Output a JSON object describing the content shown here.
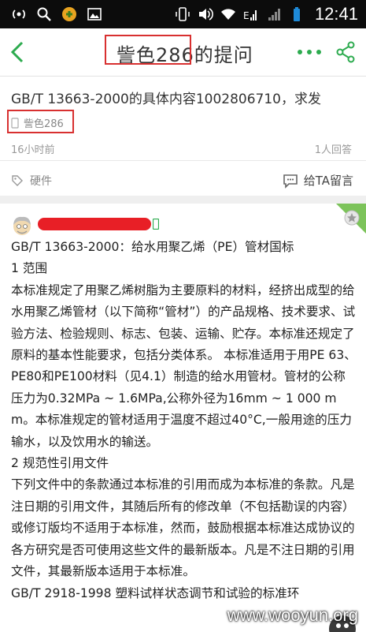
{
  "status_bar": {
    "time": "12:41"
  },
  "nav": {
    "title": "訾色286的提问"
  },
  "question": {
    "title": "GB/T 13663-2000的具体内容1002806710，求发",
    "author": "訾色286",
    "time": "16小时前",
    "answer_count": "1人回答",
    "tag": "硬件",
    "message_label": "给TA留言"
  },
  "answer": {
    "paragraphs": [
      "GB/T 13663-2000：给水用聚乙烯（PE）管材国标",
      "1 范围",
      "本标准规定了用聚乙烯树脂为主要原料的材料，经挤出成型的给水用聚乙烯管材（以下简称“管材”）的产品规格、技术要求、试验方法、检验规则、标志、包装、运输、贮存。本标准还规定了原料的基本性能要求，包括分类体系。  本标准适用于用PE 63、PE80和PE100材料（见4.1）制造的给水用管材。管材的公称压力为0.32MPa ~ 1.6MPa,公称外径为16mm ~ 1 000 mm。本标准规定的管材适用于温度不超过40°C,一般用途的压力输水，以及饮用水的输送。",
      "2 规范性引用文件",
      "下列文件中的条款通过本标准的引用而成为本标准的条款。凡是注日期的引用文件，其随后所有的修改单（不包括勘误的内容）或修订版均不适用于本标准，然而，鼓励根据本标准达成协议的各方研究是否可使用这些文件的最新版本。凡是不注日期的引用文件，其最新版本适用于本标准。",
      "GB/T 2918-1998  塑料试样状态调节和试验的标准环"
    ]
  },
  "watermark": "www.wooyun.org",
  "colors": {
    "accent_green": "#2dab4f",
    "redact_red": "#e81f26",
    "highlight_box": "#d83030"
  }
}
